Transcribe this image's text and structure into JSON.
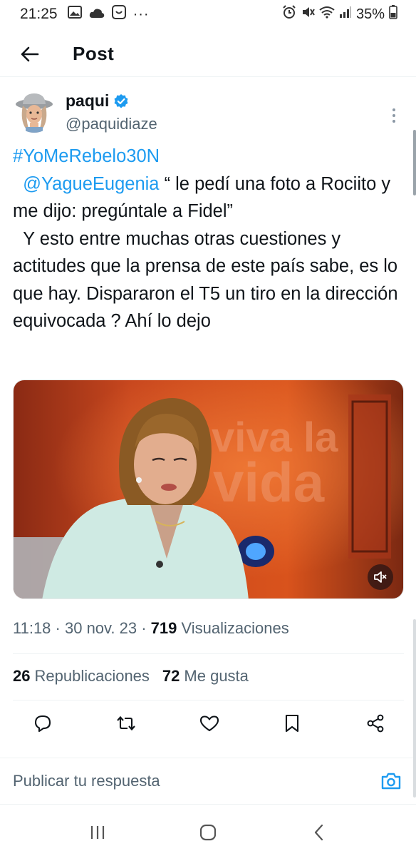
{
  "status_bar": {
    "time": "21:25",
    "dots": "···",
    "battery": "35%"
  },
  "header": {
    "title": "Post"
  },
  "author": {
    "display_name": "paqui",
    "handle": "@paquidiaze",
    "verified": true
  },
  "tweet": {
    "hashtag": "#YoMeRebelo30N",
    "mention": "@YagueEugenia",
    "text_after_mention": " “ le pedí una foto a Rociito y me dijo: pregúntale a Fidel”",
    "text_rest": "  Y esto entre muchas otras cuestiones y actitudes que la prensa de este país sabe, es lo que hay. Dispararon el T5 un tiro en la dirección equivocada ? Ahí lo dejo"
  },
  "media": {
    "overlay_text_1": "viva la",
    "overlay_text_2": "vida"
  },
  "meta": {
    "time": "11:18",
    "date": "30 nov. 23",
    "views_count": "719",
    "views_label": "Visualizaciones"
  },
  "stats": {
    "reposts_count": "26",
    "reposts_label": "Republicaciones",
    "likes_count": "72",
    "likes_label": "Me gusta"
  },
  "reply": {
    "placeholder": "Publicar tu respuesta"
  },
  "colors": {
    "accent": "#1d9bf0",
    "text": "#0f1419",
    "secondary": "#536471"
  }
}
